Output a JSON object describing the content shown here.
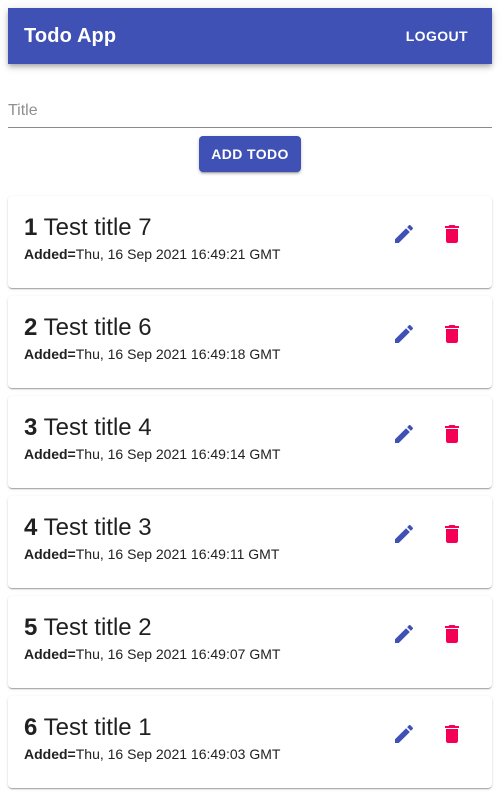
{
  "header": {
    "title": "Todo App",
    "logout_label": "LOGOUT"
  },
  "form": {
    "title_placeholder": "Title",
    "title_value": "",
    "add_label": "ADD TODO"
  },
  "added_label": "Added=",
  "todos": [
    {
      "index": "1",
      "title": "Test title 7",
      "added": "Thu, 16 Sep 2021 16:49:21 GMT"
    },
    {
      "index": "2",
      "title": "Test title 6",
      "added": "Thu, 16 Sep 2021 16:49:18 GMT"
    },
    {
      "index": "3",
      "title": "Test title 4",
      "added": "Thu, 16 Sep 2021 16:49:14 GMT"
    },
    {
      "index": "4",
      "title": "Test title 3",
      "added": "Thu, 16 Sep 2021 16:49:11 GMT"
    },
    {
      "index": "5",
      "title": "Test title 2",
      "added": "Thu, 16 Sep 2021 16:49:07 GMT"
    },
    {
      "index": "6",
      "title": "Test title 1",
      "added": "Thu, 16 Sep 2021 16:49:03 GMT"
    }
  ],
  "icons": {
    "edit": "pencil-icon",
    "delete": "trash-icon"
  },
  "colors": {
    "primary": "#3f51b5",
    "delete": "#f50057",
    "text": "#212121"
  }
}
